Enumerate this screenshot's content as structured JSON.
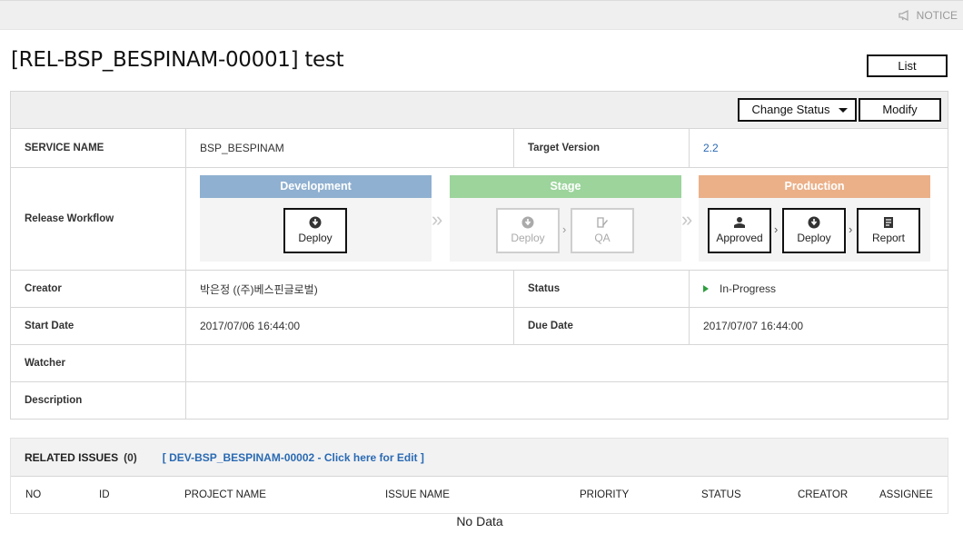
{
  "topbar": {
    "notice_label": "NOTICE"
  },
  "page": {
    "title": "[REL-BSP_BESPINAM-00001] test"
  },
  "actions": {
    "list_label": "List",
    "change_status_label": "Change Status",
    "modify_label": "Modify"
  },
  "details": {
    "service_name_label": "SERVICE NAME",
    "service_name_value": "BSP_BESPINAM",
    "target_version_label": "Target Version",
    "target_version_value": "2.2",
    "workflow_label": "Release Workflow",
    "creator_label": "Creator",
    "creator_value": "박은정 ((주)베스핀글로벌)",
    "status_label": "Status",
    "status_value": "In-Progress",
    "start_date_label": "Start Date",
    "start_date_value": "2017/07/06 16:44:00",
    "due_date_label": "Due Date",
    "due_date_value": "2017/07/07 16:44:00",
    "watcher_label": "Watcher",
    "description_label": "Description"
  },
  "workflow": {
    "development": {
      "title": "Development",
      "color": "#8fb0d0",
      "deploy_label": "Deploy"
    },
    "stage": {
      "title": "Stage",
      "color": "#9cd49c",
      "deploy_label": "Deploy",
      "qa_label": "QA"
    },
    "production": {
      "title": "Production",
      "color": "#ebb088",
      "approved_label": "Approved",
      "deploy_label": "Deploy",
      "report_label": "Report"
    }
  },
  "related_issues": {
    "title": "RELATED ISSUES",
    "count": "(0)",
    "edit_link": "[ DEV-BSP_BESPINAM-00002 - Click here for Edit ]",
    "columns": [
      "NO",
      "ID",
      "PROJECT NAME",
      "ISSUE NAME",
      "PRIORITY",
      "STATUS",
      "CREATOR",
      "ASSIGNEE"
    ],
    "empty_text": "No Data"
  }
}
